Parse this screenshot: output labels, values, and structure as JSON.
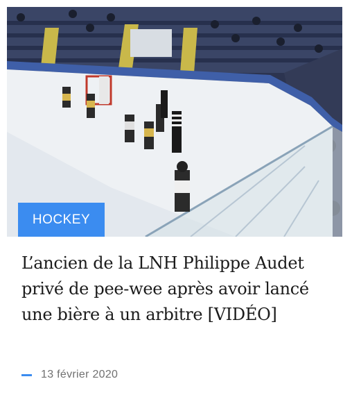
{
  "article": {
    "category": "HOCKEY",
    "title": "L’ancien de la LNH Philippe Audet privé de pee-wee après avoir lancé une bière à un arbitre [VIDÉO]",
    "date": "13 février 2020"
  },
  "colors": {
    "accent": "#3b8cf0",
    "title": "#1b1b1b",
    "date": "#707070"
  },
  "image": {
    "subject": "hockey-rink-game-photo"
  }
}
